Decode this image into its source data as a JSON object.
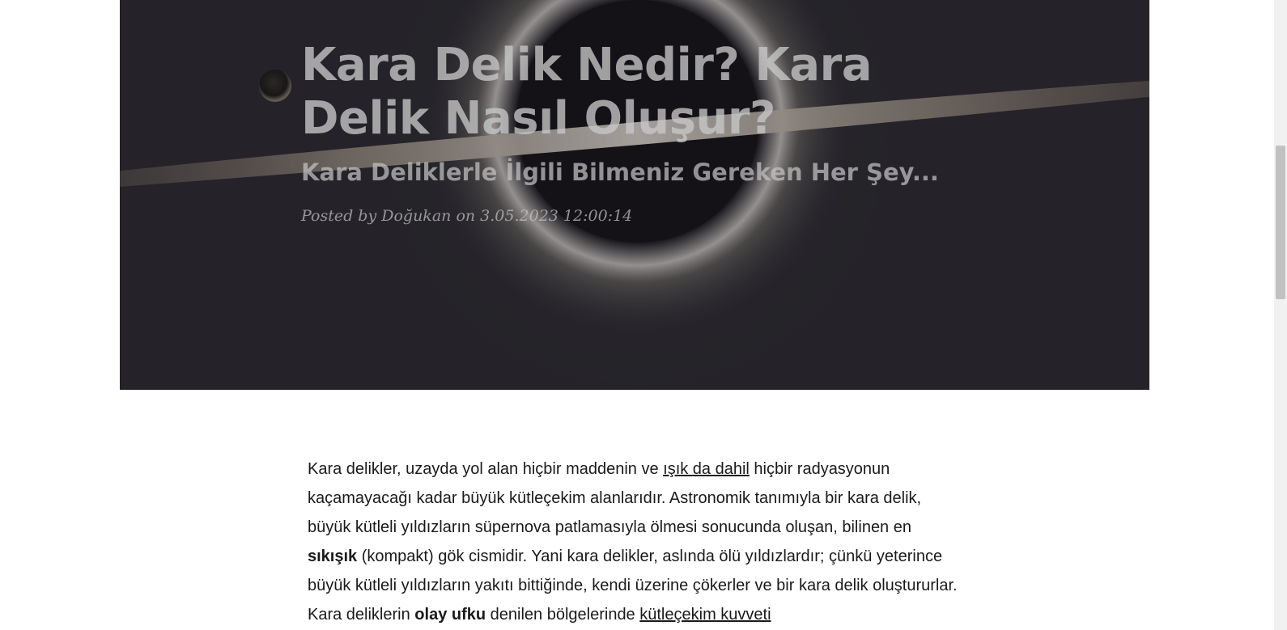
{
  "hero": {
    "title": "Kara Delik Nedir? Kara Delik Nasıl Oluşur?",
    "subtitle": "Kara Deliklerle İlgili Bilmeniz Gereken Her Şey...",
    "meta_prefix": "Posted by",
    "author": "Doğukan",
    "meta_on": "on",
    "date": "3.05.2023 12:00:14",
    "background_image": "black-hole-image"
  },
  "article": {
    "p1_s1": "Kara delikler, uzayda yol alan hiçbir maddenin ve ",
    "p1_link1": "ışık da dahil",
    "p1_s2": " hiçbir radyasyonun kaçamayacağı kadar büyük kütleçekim alanlarıdır. Astronomik tanımıyla bir kara delik, büyük kütleli yıldızların süpernova patlamasıyla ölmesi sonucunda oluşan, bilinen en ",
    "p1_bold1": "sıkışık",
    "p1_s3": " (kompakt) gök cismidir. Yani kara delikler, aslında ölü yıldızlardır; çünkü yeterince büyük kütleli yıldızların yakıtı bittiğinde, kendi üzerine çökerler ve bir kara delik oluştururlar. Kara deliklerin ",
    "p1_bold2": "olay ufku",
    "p1_s4": " denilen bölgelerinde ",
    "p1_link2": "kütleçekim kuvveti"
  },
  "colors": {
    "text": "#1a1a1a",
    "hero_text": "#c8c8c8",
    "hero_bg": "#2b2a30"
  }
}
